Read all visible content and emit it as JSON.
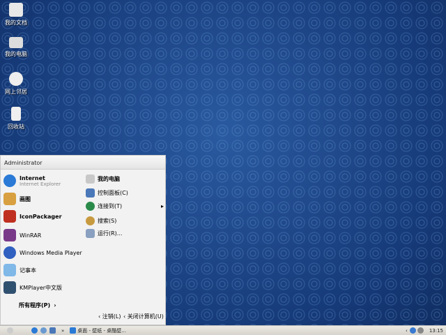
{
  "desktop": {
    "icons": [
      {
        "label": "我的文档"
      },
      {
        "label": "我的电脑"
      },
      {
        "label": "网上邻居"
      },
      {
        "label": "回收站"
      }
    ]
  },
  "start_menu": {
    "user": "Administrator",
    "left_items": [
      {
        "label": "Internet",
        "sub": "Internet Explorer",
        "color": "#2a7ad6"
      },
      {
        "label": "画图",
        "color": "#d8a040"
      },
      {
        "label": "IconPackager",
        "color": "#c03020"
      },
      {
        "label": "WinRAR",
        "color": "#7a3a8a"
      },
      {
        "label": "Windows Media Player",
        "color": "#3060c0"
      },
      {
        "label": "记事本",
        "color": "#80b8e8"
      },
      {
        "label": "KMPlayer中文版",
        "color": "#305070"
      }
    ],
    "all_programs": "所有程序(P)",
    "right_items": [
      {
        "label": "我的电脑",
        "color": "#c8c8c8"
      },
      {
        "label": "控制面板(C)",
        "color": "#4a78b8"
      },
      {
        "label": "连接到(T)",
        "color": "#2a8a4a"
      },
      {
        "label": "搜索(S)",
        "color": "#c89a40"
      },
      {
        "label": "运行(R)...",
        "color": "#8aa0c0"
      }
    ],
    "logoff": "注销(L)",
    "shutdown": "关闭计算机(U)"
  },
  "taskbar": {
    "task": "桌面 - 壁纸 - 桌酷壁...",
    "clock": "13:15"
  }
}
